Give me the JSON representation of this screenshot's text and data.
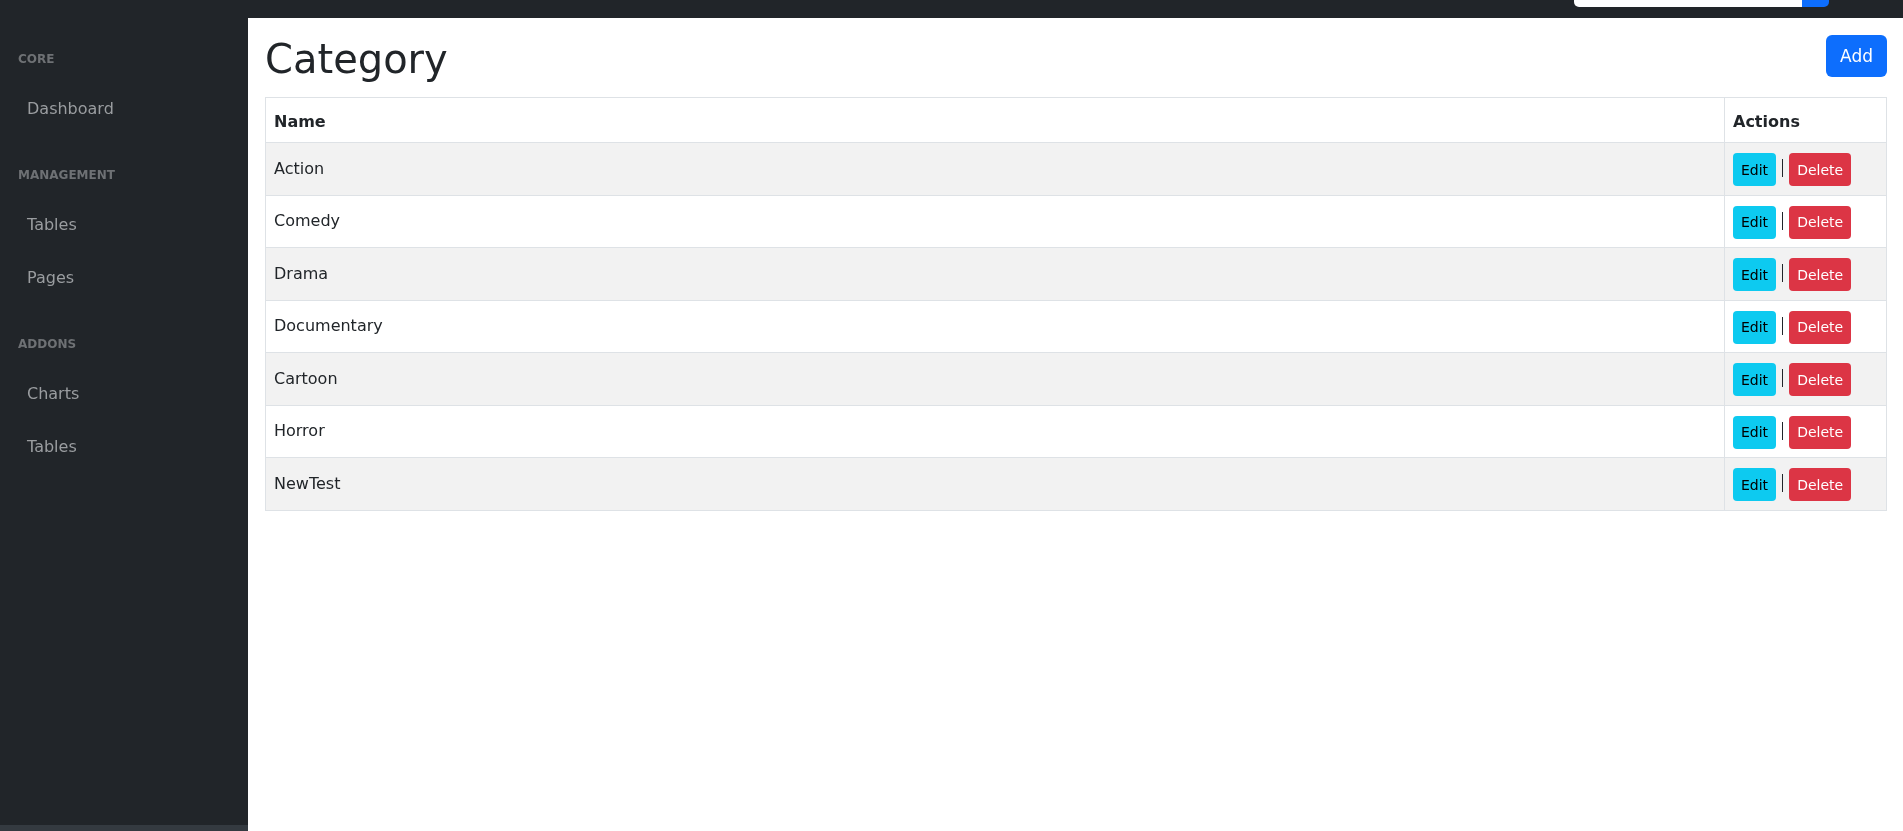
{
  "navbar": {
    "controls": [
      {
        "kind": "field"
      },
      {
        "kind": "button"
      }
    ]
  },
  "sidebar": {
    "sections": [
      {
        "heading": "CORE",
        "items": [
          {
            "label": "Dashboard",
            "selected": false
          }
        ]
      },
      {
        "heading": "MANAGEMENT",
        "items": [
          {
            "label": "Tables",
            "selected": false
          },
          {
            "label": "Pages",
            "selected": false
          }
        ]
      },
      {
        "heading": "ADDONS",
        "items": [
          {
            "label": "Charts",
            "selected": false
          },
          {
            "label": "Tables",
            "selected": false
          }
        ]
      }
    ]
  },
  "page": {
    "title": "Category",
    "add_button": "Add"
  },
  "table": {
    "columns": [
      "Name",
      "Actions"
    ],
    "rows": [
      {
        "name": "Action",
        "actions": [
          {
            "kind": "edit",
            "label": "Edit"
          },
          {
            "kind": "delete",
            "label": "Delete"
          }
        ]
      },
      {
        "name": "Comedy",
        "actions": [
          {
            "kind": "edit",
            "label": "Edit"
          },
          {
            "kind": "delete",
            "label": "Delete"
          }
        ]
      },
      {
        "name": "Drama",
        "actions": [
          {
            "kind": "edit",
            "label": "Edit"
          },
          {
            "kind": "delete",
            "label": "Delete"
          }
        ]
      },
      {
        "name": "Documentary",
        "actions": [
          {
            "kind": "edit",
            "label": "Edit"
          },
          {
            "kind": "delete",
            "label": "Delete"
          }
        ]
      },
      {
        "name": "Cartoon",
        "actions": [
          {
            "kind": "edit",
            "label": "Edit"
          },
          {
            "kind": "delete",
            "label": "Delete"
          }
        ]
      },
      {
        "name": "Horror",
        "actions": [
          {
            "kind": "edit",
            "label": "Edit"
          },
          {
            "kind": "delete",
            "label": "Delete"
          }
        ]
      },
      {
        "name": "NewTest",
        "actions": [
          {
            "kind": "edit",
            "label": "Edit"
          },
          {
            "kind": "delete",
            "label": "Delete"
          }
        ]
      }
    ]
  }
}
